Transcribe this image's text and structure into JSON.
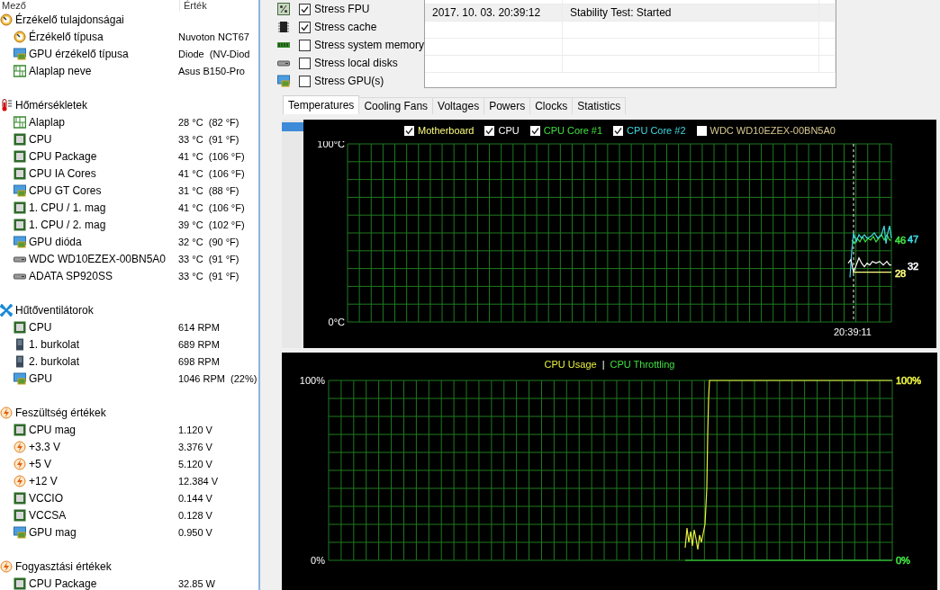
{
  "sensor_panel": {
    "columns": [
      "Mező",
      "Érték"
    ],
    "groups": [
      {
        "label": "Érzékelő tulajdonságai",
        "kind": "sensor",
        "children": [
          {
            "label": "Érzékelő típusa",
            "value": "Nuvoton NCT67",
            "kind": "sensor"
          },
          {
            "label": "GPU érzékelő típusa",
            "value": "Diode  (NV-Diod",
            "kind": "gpu"
          },
          {
            "label": "Alaplap neve",
            "value": "Asus B150-Pro",
            "kind": "board"
          }
        ]
      },
      {
        "label": "Hőmérsékletek",
        "kind": "thermo",
        "children": [
          {
            "label": "Alaplap",
            "value": "28 °C  (82 °F)",
            "kind": "board"
          },
          {
            "label": "CPU",
            "value": "33 °C  (91 °F)",
            "kind": "chip"
          },
          {
            "label": "CPU Package",
            "value": "41 °C  (106 °F)",
            "kind": "chip"
          },
          {
            "label": "CPU IA Cores",
            "value": "41 °C  (106 °F)",
            "kind": "chip"
          },
          {
            "label": "CPU GT Cores",
            "value": "31 °C  (88 °F)",
            "kind": "gpu"
          },
          {
            "label": "1. CPU / 1. mag",
            "value": "41 °C  (106 °F)",
            "kind": "chip"
          },
          {
            "label": "1. CPU / 2. mag",
            "value": "39 °C  (102 °F)",
            "kind": "chip"
          },
          {
            "label": "GPU dióda",
            "value": "32 °C  (90 °F)",
            "kind": "gpu"
          },
          {
            "label": "WDC WD10EZEX-00BN5A0",
            "value": "33 °C  (91 °F)",
            "kind": "disk"
          },
          {
            "label": "ADATA SP920SS",
            "value": "33 °C  (91 °F)",
            "kind": "disk"
          }
        ]
      },
      {
        "label": "Hűtőventilátorok",
        "kind": "fan",
        "children": [
          {
            "label": "CPU",
            "value": "614 RPM",
            "kind": "chip"
          },
          {
            "label": "1. burkolat",
            "value": "689 RPM",
            "kind": "case"
          },
          {
            "label": "2. burkolat",
            "value": "698 RPM",
            "kind": "case"
          },
          {
            "label": "GPU",
            "value": "1046 RPM  (22%)",
            "kind": "gpu"
          }
        ]
      },
      {
        "label": "Feszültség értékek",
        "kind": "bolt",
        "children": [
          {
            "label": "CPU mag",
            "value": "1.120 V",
            "kind": "chip"
          },
          {
            "label": "+3.3 V",
            "value": "3.376 V",
            "kind": "bolt"
          },
          {
            "label": "+5 V",
            "value": "5.120 V",
            "kind": "bolt"
          },
          {
            "label": "+12 V",
            "value": "12.384 V",
            "kind": "bolt"
          },
          {
            "label": "VCCIO",
            "value": "0.144 V",
            "kind": "chip"
          },
          {
            "label": "VCCSA",
            "value": "0.128 V",
            "kind": "chip"
          },
          {
            "label": "GPU mag",
            "value": "0.950 V",
            "kind": "gpu"
          }
        ]
      },
      {
        "label": "Fogyasztási értékek",
        "kind": "bolt",
        "children": [
          {
            "label": "CPU Package",
            "value": "32.85 W",
            "kind": "chip"
          }
        ]
      }
    ]
  },
  "stress_options": [
    {
      "label": "Stress FPU",
      "checked": true,
      "kind": "fpu"
    },
    {
      "label": "Stress cache",
      "checked": true,
      "kind": "cache"
    },
    {
      "label": "Stress system memory",
      "checked": false,
      "kind": "memory"
    },
    {
      "label": "Stress local disks",
      "checked": false,
      "kind": "disk"
    },
    {
      "label": "Stress GPU(s)",
      "checked": false,
      "kind": "gpu"
    }
  ],
  "log_table": {
    "rows": [
      {
        "column_1": "2017. 10. 03. 20:39:12",
        "column_2": "Stability Test: Started",
        "selected": true
      }
    ]
  },
  "tabs": [
    {
      "label": "Temperatures",
      "selected": true
    },
    {
      "label": "Cooling Fans",
      "selected": false
    },
    {
      "label": "Voltages",
      "selected": false
    },
    {
      "label": "Powers",
      "selected": false
    },
    {
      "label": "Clocks",
      "selected": false
    },
    {
      "label": "Statistics",
      "selected": false
    }
  ],
  "temperature_chart": {
    "legend": [
      {
        "label": "Motherboard",
        "checked": true,
        "color": "#ffff80"
      },
      {
        "label": "CPU",
        "checked": true,
        "color": "#ffffff"
      },
      {
        "label": "CPU Core #1",
        "checked": true,
        "color": "#40e040"
      },
      {
        "label": "CPU Core #2",
        "checked": true,
        "color": "#40d8e0"
      },
      {
        "label": "WDC WD10EZEX-00BN5A0",
        "checked": false,
        "color": "#d8c890"
      }
    ],
    "y_top": "100°C",
    "y_bottom": "0°C",
    "time_label": "20:39:11",
    "readings": [
      {
        "text": "46",
        "color": "#40e040"
      },
      {
        "text": "47",
        "color": "#40d8e0"
      },
      {
        "text": "32",
        "color": "#ffffff"
      },
      {
        "text": "28",
        "color": "#ffff80"
      }
    ]
  },
  "usage_chart": {
    "legend": [
      {
        "label": "CPU Usage",
        "color": "#e8f040"
      },
      {
        "label": "CPU Throttling",
        "color": "#40e040"
      }
    ],
    "separator": "|",
    "left_ticks": [
      "100%",
      "0%"
    ],
    "right_ticks": [
      {
        "text": "100%",
        "color": "#e8f040"
      },
      {
        "text": "0%",
        "color": "#40e040"
      }
    ]
  }
}
